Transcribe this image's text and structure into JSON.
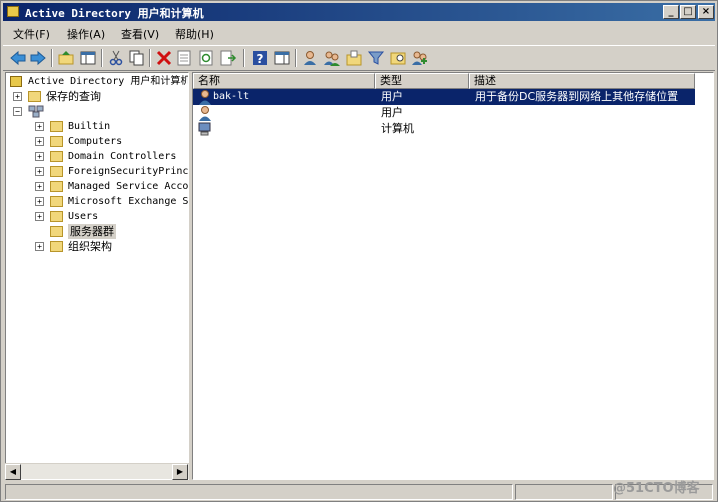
{
  "window": {
    "title": "Active Directory 用户和计算机",
    "min_glyph": "_",
    "max_glyph": "□",
    "close_glyph": "×"
  },
  "menu": [
    "文件(F)",
    "操作(A)",
    "查看(V)",
    "帮助(H)"
  ],
  "toolbar": [
    "back-icon",
    "forward-icon",
    "up-folder-icon",
    "show-console-tree-icon",
    "cut-icon",
    "copy-icon",
    "delete-icon",
    "properties-icon",
    "refresh-icon",
    "export-list-icon",
    "help-icon",
    "show-hide-pane-icon",
    "new-user-icon",
    "new-group-icon",
    "new-ou-icon",
    "filter-icon",
    "find-icon",
    "add-to-group-icon"
  ],
  "tree": {
    "root": "Active Directory 用户和计算机",
    "saved_queries": "保存的查询",
    "domain": "",
    "children": [
      "Builtin",
      "Computers",
      "Domain Controllers",
      "ForeignSecurityPrincip",
      "Managed Service Accour",
      "Microsoft Exchange Sec",
      "Users",
      "服务器群",
      "组织架构"
    ],
    "selected": "服务器群"
  },
  "list": {
    "columns": [
      "名称",
      "类型",
      "描述"
    ],
    "rows": [
      {
        "name": "bak-lt",
        "type": "用户",
        "desc": "用于备份DC服务器到网络上其他存储位置",
        "icon": "user-icon",
        "selected": true
      },
      {
        "name": "",
        "type": "用户",
        "desc": "",
        "icon": "user-icon",
        "selected": false
      },
      {
        "name": "",
        "type": "计算机",
        "desc": "",
        "icon": "computer-icon",
        "selected": false
      }
    ]
  },
  "status": {
    "left": "",
    "mid": "",
    "right": ""
  },
  "watermark": "@51CTO博客",
  "colors": {
    "title_start": "#0a246a",
    "title_end": "#3a6ea5",
    "selection": "#0a246a",
    "window": "#d4d0c8"
  }
}
